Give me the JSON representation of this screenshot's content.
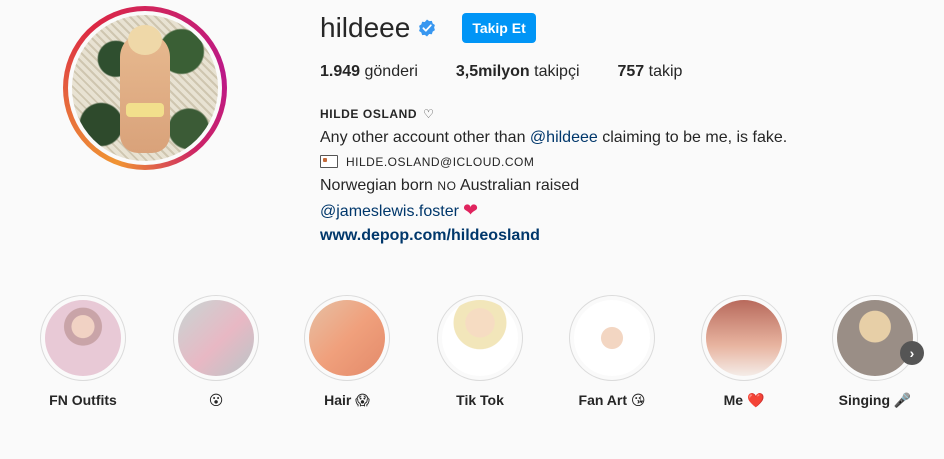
{
  "profile": {
    "username": "hildeee",
    "follow_label": "Takip Et",
    "stats": {
      "posts_count": "1.949",
      "posts_label": "gönderi",
      "followers_count": "3,5milyon",
      "followers_label": "takipçi",
      "following_count": "757",
      "following_label": "takip"
    }
  },
  "bio": {
    "name": "HILDE OSLAND",
    "name_symbol": "♡",
    "line1_prefix": "Any other account other than ",
    "line1_mention": "@hildeee",
    "line1_suffix": " claiming to be me, is fake.",
    "email": "HILDE.OSLAND@ICLOUD.COM",
    "line3_prefix": "Norwegian born ",
    "line3_small": "NO",
    "line3_suffix": " Australian raised",
    "mention2": "@jameslewis.foster",
    "heart_emoji": "❤",
    "website": "www.depop.com/hildeosland"
  },
  "highlights": [
    {
      "label": "FN Outfits"
    },
    {
      "label": "😮"
    },
    {
      "label": "Hair 😱"
    },
    {
      "label": "Tik Tok"
    },
    {
      "label": "Fan Art 😘"
    },
    {
      "label": "Me ❤️"
    },
    {
      "label": "Singing 🎤"
    }
  ],
  "icons": {
    "next_arrow": "›",
    "verified_color": "#3897f0",
    "follow_button_color": "#0095f6"
  }
}
